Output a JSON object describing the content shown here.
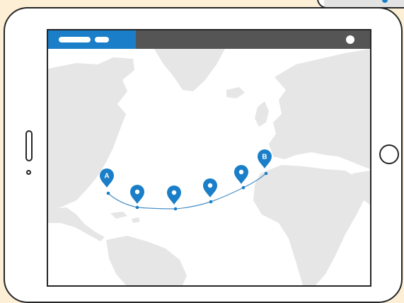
{
  "colors": {
    "page_background": "#fcefd6",
    "accent": "#1a7fc8",
    "top_bar": "#555555",
    "land": "#e6e6e6",
    "route": "#4a90c8"
  },
  "map": {
    "icons": {
      "pin": "map-pin-icon",
      "menu": "menu-dot-icon"
    },
    "start_label": "A",
    "end_label": "B",
    "waypoint_count": 4
  }
}
